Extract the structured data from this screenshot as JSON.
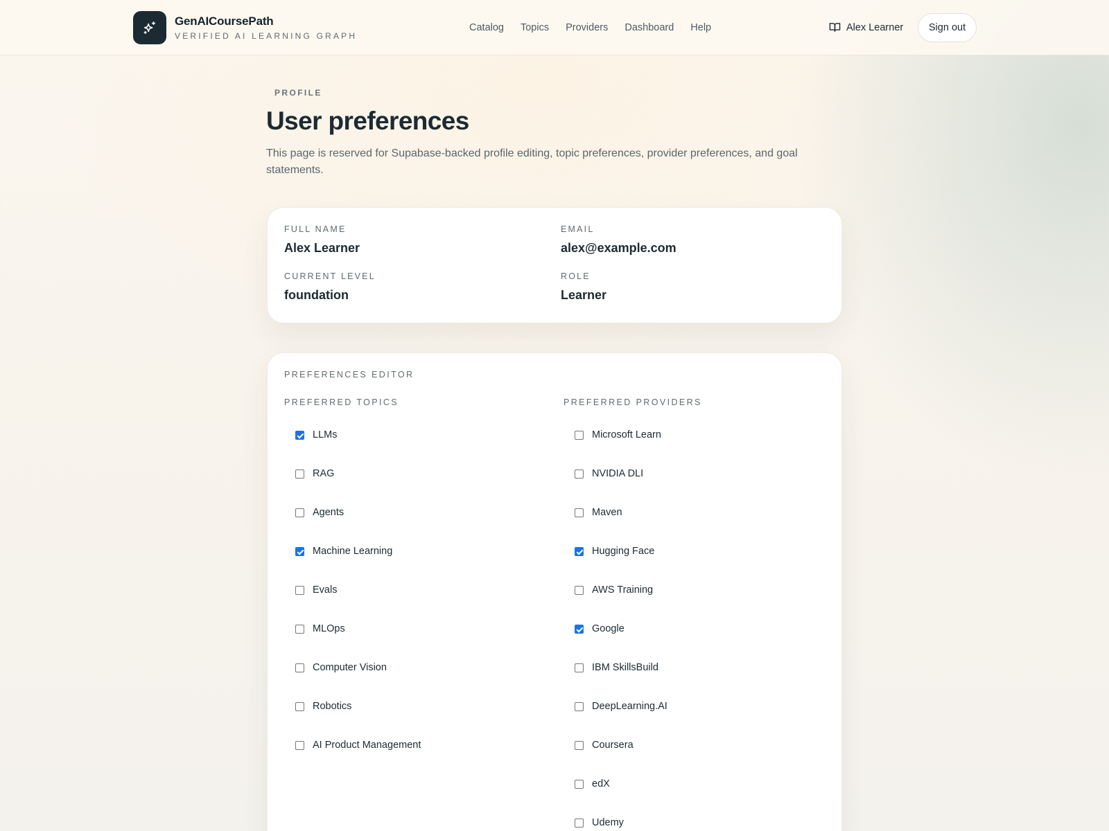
{
  "header": {
    "brand_name": "GenAICoursePath",
    "brand_tagline": "VERIFIED AI LEARNING GRAPH",
    "nav": [
      "Catalog",
      "Topics",
      "Providers",
      "Dashboard",
      "Help"
    ],
    "user_name": "Alex Learner",
    "signout_label": "Sign out"
  },
  "page": {
    "eyebrow": "PROFILE",
    "title": "User preferences",
    "description": "This page is reserved for Supabase-backed profile editing, topic preferences, provider preferences, and goal statements."
  },
  "profile": {
    "full_name_label": "FULL NAME",
    "full_name": "Alex Learner",
    "email_label": "EMAIL",
    "email": "alex@example.com",
    "level_label": "CURRENT LEVEL",
    "level": "foundation",
    "role_label": "ROLE",
    "role": "Learner"
  },
  "preferences": {
    "editor_label": "PREFERENCES EDITOR",
    "topics_label": "PREFERRED TOPICS",
    "providers_label": "PREFERRED PROVIDERS",
    "topics": [
      {
        "label": "LLMs",
        "checked": true
      },
      {
        "label": "RAG",
        "checked": false
      },
      {
        "label": "Agents",
        "checked": false
      },
      {
        "label": "Machine Learning",
        "checked": true
      },
      {
        "label": "Evals",
        "checked": false
      },
      {
        "label": "MLOps",
        "checked": false
      },
      {
        "label": "Computer Vision",
        "checked": false
      },
      {
        "label": "Robotics",
        "checked": false
      },
      {
        "label": "AI Product Management",
        "checked": false
      }
    ],
    "providers": [
      {
        "label": "Microsoft Learn",
        "checked": false
      },
      {
        "label": "NVIDIA DLI",
        "checked": false
      },
      {
        "label": "Maven",
        "checked": false
      },
      {
        "label": "Hugging Face",
        "checked": true
      },
      {
        "label": "AWS Training",
        "checked": false
      },
      {
        "label": "Google",
        "checked": true
      },
      {
        "label": "IBM SkillsBuild",
        "checked": false
      },
      {
        "label": "DeepLearning.AI",
        "checked": false
      },
      {
        "label": "Coursera",
        "checked": false
      },
      {
        "label": "edX",
        "checked": false
      },
      {
        "label": "Udemy",
        "checked": false
      }
    ]
  },
  "icons": {
    "brand": "sparkles-icon",
    "user": "book-open-icon"
  },
  "colors": {
    "accent": "#1a73e8",
    "brand_dark": "#1c2a33"
  }
}
